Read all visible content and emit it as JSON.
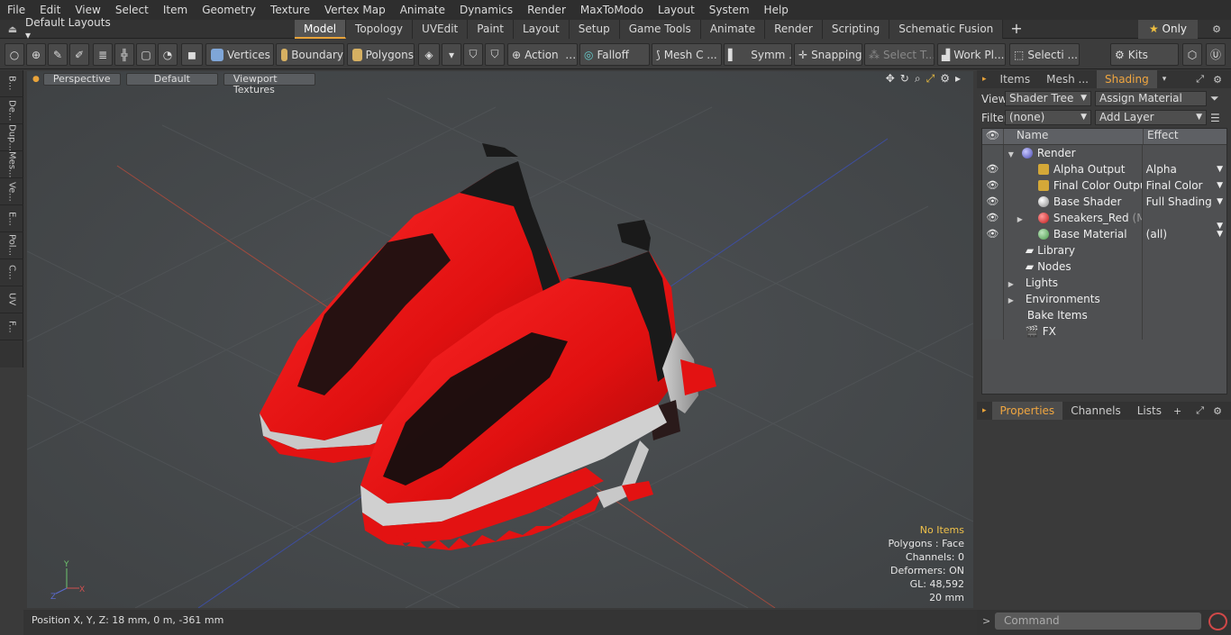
{
  "menu": [
    "File",
    "Edit",
    "View",
    "Select",
    "Item",
    "Geometry",
    "Texture",
    "Vertex Map",
    "Animate",
    "Dynamics",
    "Render",
    "MaxToModo",
    "Layout",
    "System",
    "Help"
  ],
  "layout_selector": "Default Layouts",
  "tabs": [
    "Model",
    "Topology",
    "UVEdit",
    "Paint",
    "Layout",
    "Setup",
    "Game Tools",
    "Animate",
    "Render",
    "Scripting",
    "Schematic Fusion"
  ],
  "only_label": "Only",
  "toolbar": {
    "vertices": "Vertices",
    "boundary": "Boundary",
    "polygons": "Polygons",
    "action": "Action",
    "falloff": "Falloff",
    "mesh": "Mesh C ...",
    "symm": "Symm ...",
    "snapping": "Snapping",
    "select_t": "Select T...",
    "work_pl": "Work Pl...",
    "selecti": "Selecti ...",
    "kits": "Kits"
  },
  "left_tabs": [
    "B...",
    "De...",
    "Dup...",
    "Mes...",
    "Ve...",
    "E...",
    "Pol...",
    "C...",
    "UV",
    "F..."
  ],
  "viewport": {
    "perspective": "Perspective",
    "default": "Default",
    "textures": "Viewport Textures",
    "stats": {
      "no_items": "No Items",
      "polygons": "Polygons : Face",
      "channels": "Channels: 0",
      "deformers": "Deformers: ON",
      "gl": "GL: 48,592",
      "scale": "20 mm"
    }
  },
  "status": "Position X, Y, Z:   18 mm, 0 m, -361 mm",
  "right_panel": {
    "tabs": [
      "Items",
      "Mesh ...",
      "Shading"
    ],
    "view_label": "View",
    "view_value": "Shader Tree",
    "assign": "Assign Material",
    "filter_label": "Filter",
    "filter_value": "(none)",
    "add_layer": "Add Layer",
    "col_name": "Name",
    "col_effect": "Effect",
    "tree": [
      {
        "name": "Render",
        "effect": ""
      },
      {
        "name": "Alpha Output",
        "effect": "Alpha"
      },
      {
        "name": "Final Color Output",
        "effect": "Final Color"
      },
      {
        "name": "Base Shader",
        "effect": "Full Shading"
      },
      {
        "name": "Sneakers_Red",
        "suffix": "(M...",
        "effect": ""
      },
      {
        "name": "Base Material",
        "effect": "(all)"
      },
      {
        "name": "Library",
        "effect": ""
      },
      {
        "name": "Nodes",
        "effect": ""
      },
      {
        "name": "Lights",
        "effect": ""
      },
      {
        "name": "Environments",
        "effect": ""
      },
      {
        "name": "Bake Items",
        "effect": ""
      },
      {
        "name": "FX",
        "effect": ""
      }
    ]
  },
  "props_panel": {
    "tabs": [
      "Properties",
      "Channels",
      "Lists"
    ]
  },
  "command_placeholder": "Command",
  "colors": {
    "accent": "#e8a33a",
    "sneaker_red": "#e01414",
    "viewport_bg": "#474a4d"
  }
}
